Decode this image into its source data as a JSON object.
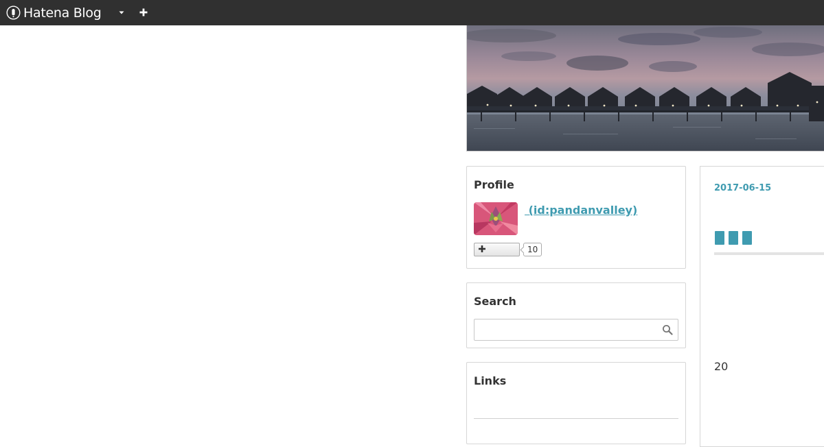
{
  "topbar": {
    "brand_icon": "hatena-logo-icon",
    "brand_name": "Hatena Blog",
    "dropdown_icon": "caret-down-icon",
    "add_icon": "plus-icon",
    "background": "#303030"
  },
  "header": {
    "image": "header-image"
  },
  "profile": {
    "title": "Profile",
    "avatar": "avatar-image",
    "user_link": " (id:pandanvalley)",
    "follow_icon": "plus-icon",
    "follow_label": "",
    "follow_count": "10"
  },
  "search": {
    "title": "Search",
    "input_value": "",
    "placeholder": "",
    "icon": "search-icon"
  },
  "links": {
    "title": "Links"
  },
  "entry": {
    "date": "2017-06-15",
    "number": "20"
  },
  "colors": {
    "accent": "#3f9bb0",
    "topbar": "#303030",
    "border": "#d6d6d6"
  }
}
